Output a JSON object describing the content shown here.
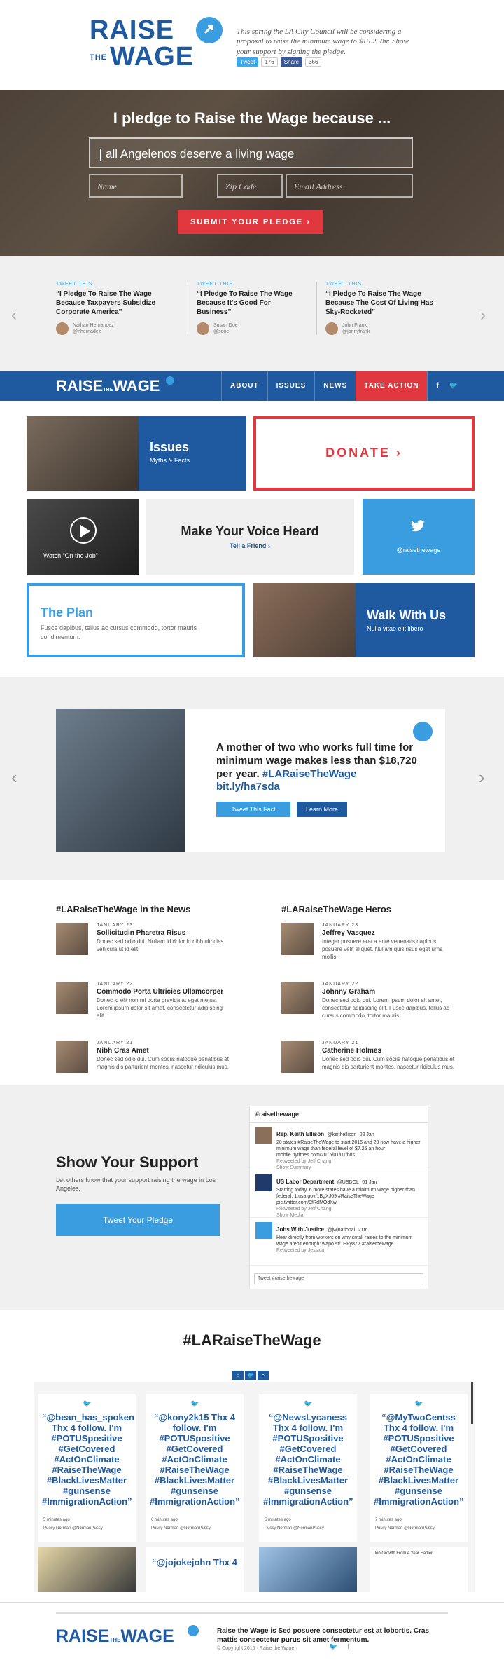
{
  "brand": {
    "logo_line1": "RAISE",
    "logo_the": "THE",
    "logo_line2": "WAGE",
    "blurb": "This spring the LA City Council will be considering a proposal to raise the minimum wage to $15.25/hr. Show your support by signing the pledge.",
    "share_tweet_label": "Tweet",
    "share_tweet_count": "176",
    "share_fb_label": "Share",
    "share_fb_count": "366"
  },
  "hero": {
    "heading": "I pledge to Raise the Wage because ...",
    "pledge_value": "all Angelenos deserve a living wage",
    "name_placeholder": "Name",
    "zip_placeholder": "Zip Code",
    "email_placeholder": "Email Address",
    "submit_label": "SUBMIT YOUR PLEDGE",
    "submit_arrow": "›"
  },
  "tweets": {
    "prev_arrow": "‹",
    "next_arrow": "›",
    "items": [
      {
        "tag": "TWEET THIS",
        "text": "“I Pledge To Raise The Wage Because Taxpayers Subsidize Corporate America”",
        "name": "Nathan Hernandez",
        "handle": "@nhernadez"
      },
      {
        "tag": "TWEET THIS",
        "text": "“I Pledge To Raise The Wage Because It's Good For Business”",
        "name": "Susan Doe",
        "handle": "@sdoe"
      },
      {
        "tag": "TWEET THIS",
        "text": "“I Pledge To Raise The Wage Because The Cost Of Living Has Sky-Rocketed”",
        "name": "John Frank",
        "handle": "@jonnyfrank"
      }
    ]
  },
  "nav": {
    "logo_raise": "RAISE",
    "logo_the": "THE",
    "logo_wage": "WAGE",
    "items": [
      "ABOUT",
      "ISSUES",
      "NEWS",
      "TAKE ACTION"
    ],
    "fb": "f",
    "tw": "🐦"
  },
  "grid": {
    "issues_title": "Issues",
    "issues_sub": "Myths & Facts",
    "donate_label": "DONATE",
    "donate_arrow": "›",
    "video_caption": "Watch “On the Job”",
    "voice_title": "Make Your Voice Heard",
    "voice_link": "Tell a Friend",
    "voice_arrow": "›",
    "twitter_handle": "@raisethewage",
    "plan_title": "The Plan",
    "plan_body": "Fusce dapibus, tellus ac cursus commodo, tortor mauris condimentum.",
    "walk_title": "Walk With Us",
    "walk_body": "Nulla vitae elit libero"
  },
  "fact": {
    "prev_arrow": "‹",
    "next_arrow": "›",
    "text_plain": "A mother of two who works full time for minimum wage makes less than $18,720 per year.",
    "text_hashtag": "#LARaiseTheWage",
    "text_link": "bit.ly/ha7sda",
    "tweet_button": "Tweet This Fact",
    "more_button": "Learn More"
  },
  "news": {
    "left_title": "#LARaiseTheWage in the News",
    "right_title": "#LARaiseTheWage Heros",
    "left": [
      {
        "date": "JANUARY 23",
        "title": "Sollicitudin Pharetra Risus",
        "body": "Donec sed odio dui. Nullam id dolor id nibh ultricies vehicula ut id elit."
      },
      {
        "date": "JANUARY 22",
        "title": "Commodo Porta Ultricies Ullamcorper",
        "body": "Donec id elit non mi porta gravida at eget metus. Lorem ipsum dolor sit amet, consectetur adipiscing elit."
      },
      {
        "date": "JANUARY 21",
        "title": "Nibh Cras Amet",
        "body": "Donec sed odio dui. Cum sociis natoque penatibus et magnis dis parturient montes, nascetur ridiculus mus."
      }
    ],
    "right": [
      {
        "date": "JANUARY 23",
        "title": "Jeffrey Vasquez",
        "body": "Integer posuere erat a ante venenatis dapibus posuere velit aliquet. Nullam quis risus eget urna mollis."
      },
      {
        "date": "JANUARY 22",
        "title": "Johnny Graham",
        "body": "Donec sed odio dui. Lorem ipsum dolor sit amet, consectetur adipiscing elit. Fusce dapibus, tellus ac cursus commodo, tortor mauris."
      },
      {
        "date": "JANUARY 21",
        "title": "Catherine Holmes",
        "body": "Donec sed odio dui. Cum sociis natoque penatibus et magnis dis parturient montes, nascetur ridiculus mus."
      }
    ]
  },
  "support": {
    "title": "Show Your Support",
    "body": "Let others know that your support raising the wage in Los Angeles.",
    "button": "Tweet Your Pledge",
    "widget_title": "#raisethewage",
    "widget_footer": "Tweet #raisethewage",
    "widget_tweets": [
      {
        "name": "Rep. Keith Ellison",
        "handle": "@keithellison",
        "time": "02 Jan",
        "text": "20 states #RaiseTheWage to start 2015 and 29 now have a higher minimum wage than federal level of $7.25 an hour: mobile.nytimes.com/2015/01/01/bus...",
        "meta": "Retweeted by Jeff Chang",
        "action": "Show Summary"
      },
      {
        "name": "US Labor Department",
        "handle": "@USDOL",
        "time": "01 Jan",
        "text": "Starting today, 6 more states have a minimum wage higher than federal: 1.usa.gov/1BgXJ69 #RaiseTheWage pic.twitter.com/9fRdMOdKw",
        "meta": "Retweeted by Jeff Chang",
        "action": "Show Media"
      },
      {
        "name": "Jobs With Justice",
        "handle": "@jwjnational",
        "time": "21m",
        "text": "Hear directly from workers on why small raises to the minimum wage aren't enough: wapo.st/1HFy8Z7 #raisethewage",
        "meta": "Retweeted by Jessica",
        "action": ""
      }
    ]
  },
  "social": {
    "title": "#LARaiseTheWage",
    "toolbar": [
      "⌂",
      "🐦",
      "⌕"
    ],
    "cards": [
      {
        "text": "“@bean_has_spoken Thx 4 follow. I'm #POTUSpositive #GetCovered #ActOnClimate #RaiseTheWage #BlackLivesMatter #gunsense #ImmigrationAction”",
        "ago": "5 minutes ago",
        "by": "Pussy Norman @NormanPussy"
      },
      {
        "text": "“@kony2k15 Thx 4 follow. I'm #POTUSpositive #GetCovered #ActOnClimate #RaiseTheWage #BlackLivesMatter #gunsense #ImmigrationAction”",
        "ago": "6 minutes ago",
        "by": "Pussy Norman @NormanPussy"
      },
      {
        "text": "“@NewsLycaness Thx 4 follow. I'm #POTUSpositive #GetCovered #ActOnClimate #RaiseTheWage #BlackLivesMatter #gunsense #ImmigrationAction”",
        "ago": "6 minutes ago",
        "by": "Pussy Norman @NormanPussy"
      },
      {
        "text": "“@MyTwoCentss Thx 4 follow. I'm #POTUSpositive #GetCovered #ActOnClimate #RaiseTheWage #BlackLivesMatter #gunsense #ImmigrationAction”",
        "ago": "7 minutes ago",
        "by": "Pussy Norman @NormanPussy"
      }
    ],
    "second_row_text": "“@jojokejohn Thx 4",
    "chart_card_title": "Job Growth From A Year Earlier"
  },
  "footer": {
    "logo_raise": "RAISE",
    "logo_the": "THE",
    "logo_wage": "WAGE",
    "tagline": "Raise the Wage is Sed posuere consectetur est at lobortis. Cras mattis consectetur purus sit amet fermentum.",
    "copyright": "© Copyright 2015  ·  Raise the Wage  ·",
    "tw": "🐦",
    "fb": "f"
  }
}
